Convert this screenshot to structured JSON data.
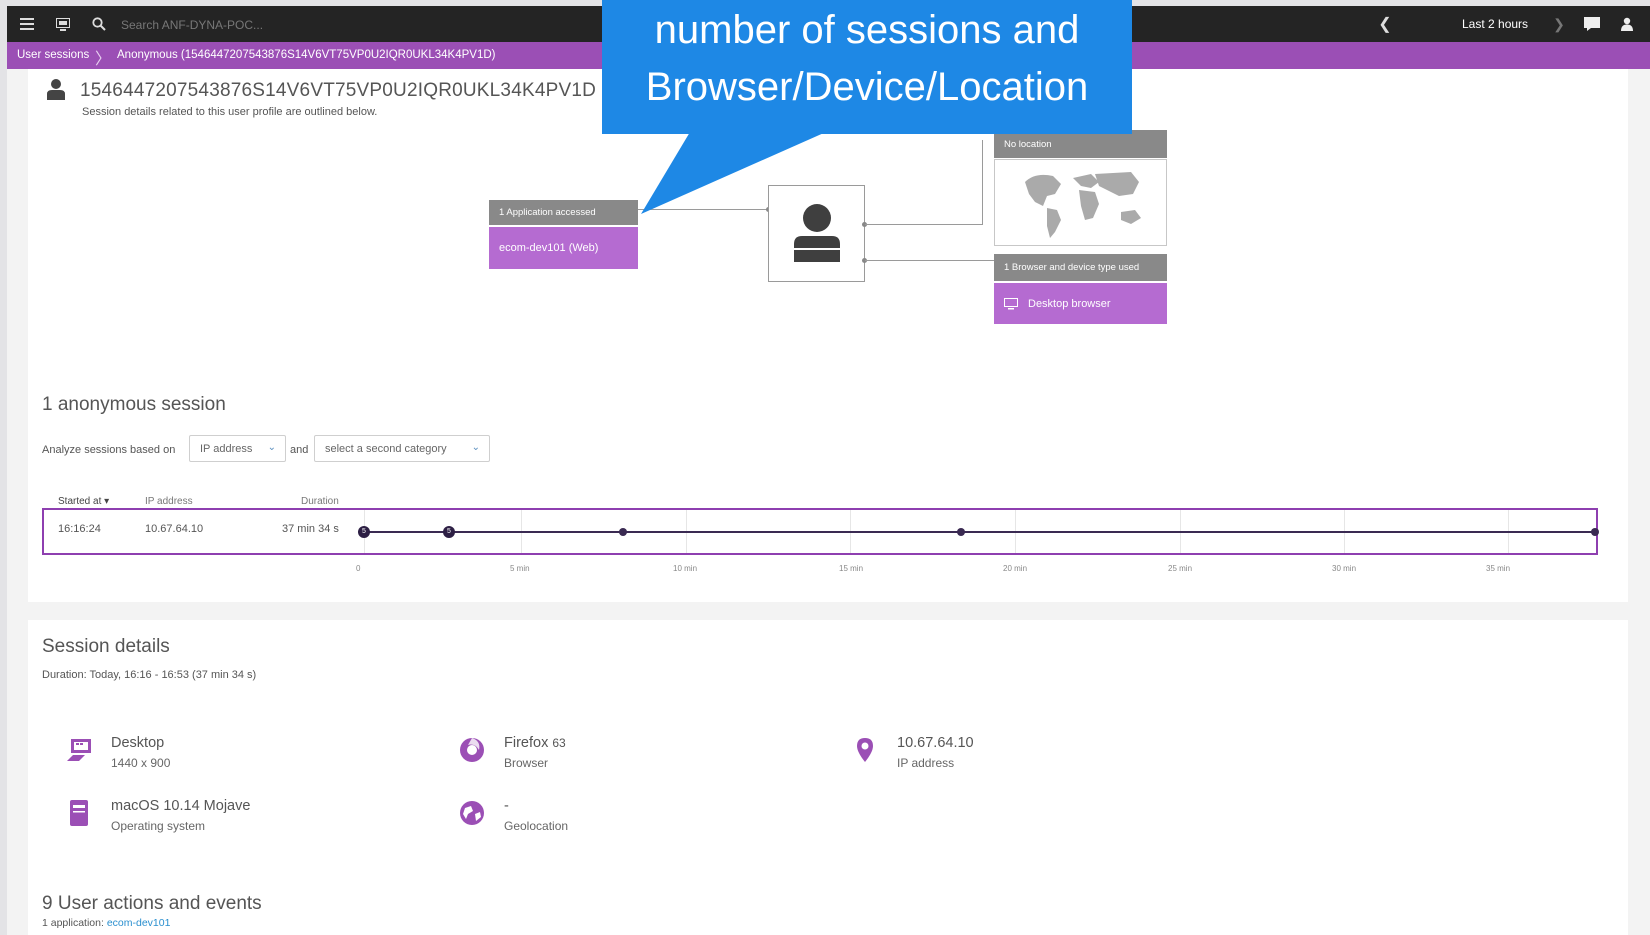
{
  "topbar": {
    "search_placeholder": "Search ANF-DYNA-POC...",
    "timeframe": "Last 2 hours"
  },
  "breadcrumb": {
    "root": "User sessions",
    "current": "Anonymous (1546447207543876S14V6VT75VP0U2IQR0UKL34K4PV1D)"
  },
  "user": {
    "id": "1546447207543876S14V6VT75VP0U2IQR0UKL34K4PV1D",
    "subtitle": "Session details related to this user profile are outlined below."
  },
  "diagram": {
    "apps_header": "1 Application accessed",
    "app_name": "ecom-dev101 (Web)",
    "location_header": "No location",
    "browser_header": "1 Browser and device type used",
    "browser_name": "Desktop browser"
  },
  "callout": {
    "line1": "number of sessions and",
    "line2": "Browser/Device/Location"
  },
  "sessions": {
    "title": "1 anonymous session",
    "analyze_label": "Analyze sessions based on",
    "category1": "IP address",
    "and_label": "and",
    "category2": "select a second category",
    "columns": [
      "Started at ▾",
      "IP address",
      "Duration"
    ],
    "row": {
      "started": "16:16:24",
      "ip": "10.67.64.10",
      "duration": "37 min 34 s"
    },
    "ticks": [
      "0",
      "5 min",
      "10 min",
      "15 min",
      "20 min",
      "25 min",
      "30 min",
      "35 min"
    ],
    "event_markers": [
      "5",
      "5"
    ]
  },
  "details": {
    "title": "Session details",
    "duration": "Duration: Today, 16:16 - 16:53 (37 min 34 s)",
    "device": "Desktop",
    "resolution": "1440 x 900",
    "browser": "Firefox",
    "browser_version": "63",
    "browser_sub": "Browser",
    "ip": "10.67.64.10",
    "ip_sub": "IP address",
    "os": "macOS 10.14 Mojave",
    "os_sub": "Operating system",
    "geo": "-",
    "geo_sub": "Geolocation"
  },
  "actions": {
    "title": "9 User actions and events",
    "sub_prefix": "1 application:",
    "app_link": "ecom-dev101"
  },
  "colors": {
    "brand_purple": "#9b4fb5",
    "box_purple": "#b56bd1",
    "callout_blue": "#1e88e5",
    "topbar": "#242424"
  }
}
